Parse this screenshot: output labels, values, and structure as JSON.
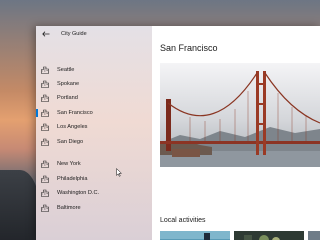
{
  "app": {
    "title": "City Guide"
  },
  "nav": {
    "items": [
      {
        "label": "Seattle"
      },
      {
        "label": "Spokane"
      },
      {
        "label": "Portland"
      },
      {
        "label": "San Francisco",
        "selected": true
      },
      {
        "label": "Los Angeles"
      },
      {
        "label": "San Diego"
      },
      {
        "label": "New York"
      },
      {
        "label": "Philadelphia"
      },
      {
        "label": "Washington D.C."
      },
      {
        "label": "Baltimore"
      }
    ]
  },
  "main": {
    "title": "San Francisco",
    "section": "Local activities"
  },
  "colors": {
    "accent": "#0078d7"
  }
}
